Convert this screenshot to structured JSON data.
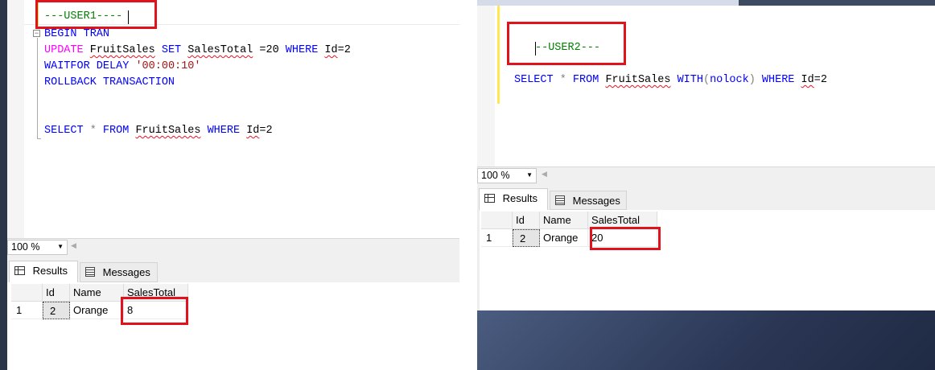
{
  "left": {
    "code": {
      "user_comment": "---USER1----",
      "begin": "BEGIN TRAN",
      "update_kw": "UPDATE",
      "table": "FruitSales",
      "set_kw": "SET",
      "col": "SalesTotal",
      "assign": " =20 ",
      "where_kw": "WHERE",
      "id": "Id",
      "eq2": "=2",
      "waitfor": "WAITFOR DELAY",
      "delay": "'00:00:10'",
      "rollback": "ROLLBACK TRANSACTION",
      "select_kw": "SELECT",
      "star": " * ",
      "from_kw": "FROM"
    },
    "zoom": "100 %",
    "tabs": {
      "results": "Results",
      "messages": "Messages"
    },
    "columns": [
      "Id",
      "Name",
      "SalesTotal"
    ],
    "row": {
      "num": "1",
      "id": "2",
      "name": "Orange",
      "total": "8"
    }
  },
  "right": {
    "code": {
      "user_comment": "--USER2---",
      "select_kw": "SELECT",
      "star": " * ",
      "from_kw": "FROM",
      "table": "FruitSales",
      "with_kw": "WITH",
      "nolock": "(nolock)",
      "where_kw": "WHERE",
      "id": "Id",
      "eq2": "=2"
    },
    "zoom": "100 %",
    "tabs": {
      "results": "Results",
      "messages": "Messages"
    },
    "columns": [
      "Id",
      "Name",
      "SalesTotal"
    ],
    "row": {
      "num": "1",
      "id": "2",
      "name": "Orange",
      "total": "20"
    }
  },
  "colors": {
    "highlight_box": "#e0121b",
    "keyword": "#0000ff",
    "function": "#ff00ff",
    "comment": "#008000",
    "string": "#a31515"
  }
}
